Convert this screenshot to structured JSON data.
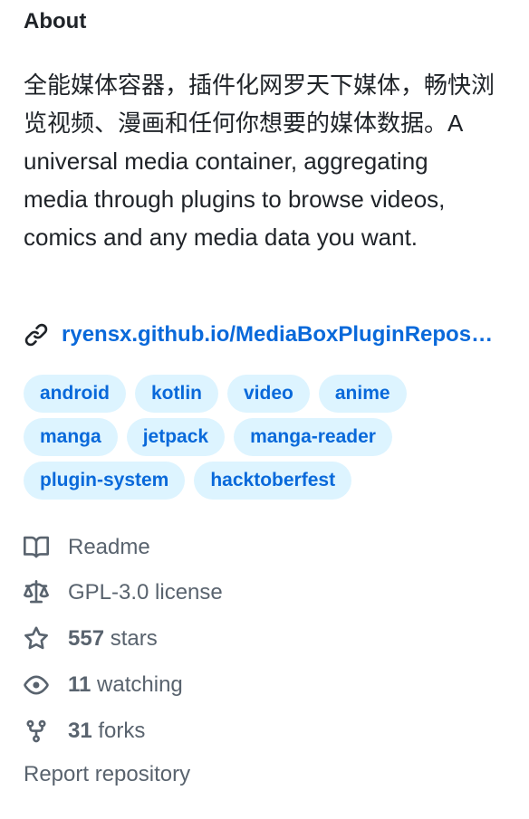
{
  "about": {
    "heading": "About",
    "description": "全能媒体容器，插件化网罗天下媒体，畅快浏览视频、漫画和任何你想要的媒体数据。A universal media container, aggregating media through plugins to browse videos, comics and any media data you want.",
    "homepage_text": "ryensx.github.io/MediaBoxPluginRepository",
    "link_icon": "link-icon",
    "link_color": "#0969da"
  },
  "topics": [
    [
      "android",
      "kotlin",
      "video",
      "anime"
    ],
    [
      "manga",
      "jetpack",
      "manga-reader"
    ],
    [
      "plugin-system",
      "hacktoberfest"
    ]
  ],
  "stats": {
    "readme": {
      "icon": "book-icon",
      "label": "Readme"
    },
    "license": {
      "icon": "law-icon",
      "label": "GPL-3.0 license"
    },
    "stars": {
      "icon": "star-icon",
      "count": "557",
      "label": " stars"
    },
    "watching": {
      "icon": "eye-icon",
      "count": "11",
      "label": " watching"
    },
    "forks": {
      "icon": "fork-icon",
      "count": "31",
      "label": " forks"
    }
  },
  "report": {
    "label": "Report repository"
  },
  "colors": {
    "text_primary": "#1f2328",
    "text_muted": "#59636e",
    "accent": "#0969da",
    "topic_bg": "#ddf4ff"
  }
}
